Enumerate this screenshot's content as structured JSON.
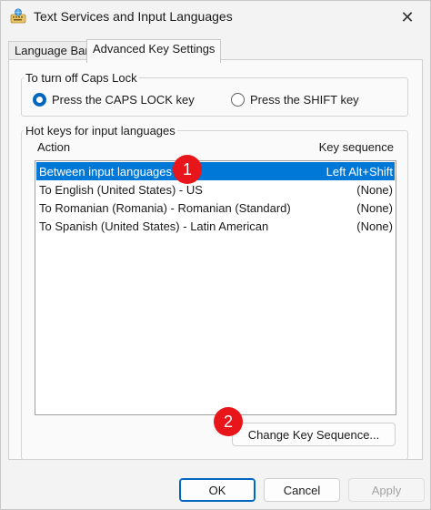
{
  "window": {
    "title": "Text Services and Input Languages",
    "close_glyph": "✕",
    "icon": "keyboard-globe-icon"
  },
  "tabs": [
    {
      "label": "Language Bar",
      "active": false
    },
    {
      "label": "Advanced Key Settings",
      "active": true
    }
  ],
  "caps_lock": {
    "legend": "To turn off Caps Lock",
    "options": [
      {
        "label": "Press the CAPS LOCK key",
        "checked": true
      },
      {
        "label": "Press the SHIFT key",
        "checked": false
      }
    ]
  },
  "hotkeys": {
    "legend": "Hot keys for input languages",
    "columns": {
      "action": "Action",
      "key_sequence": "Key sequence"
    },
    "rows": [
      {
        "action": "Between input languages",
        "key": "Left Alt+Shift",
        "selected": true
      },
      {
        "action": "To English (United States) - US",
        "key": "(None)",
        "selected": false
      },
      {
        "action": "To Romanian (Romania) - Romanian (Standard)",
        "key": "(None)",
        "selected": false
      },
      {
        "action": "To Spanish (United States) - Latin American",
        "key": "(None)",
        "selected": false
      }
    ],
    "change_button": "Change Key Sequence..."
  },
  "badges": [
    "1",
    "2"
  ],
  "footer": {
    "ok": "OK",
    "cancel": "Cancel",
    "apply": "Apply"
  },
  "colors": {
    "accent": "#0067c0",
    "selection": "#0078d7",
    "badge": "#e8161b"
  }
}
